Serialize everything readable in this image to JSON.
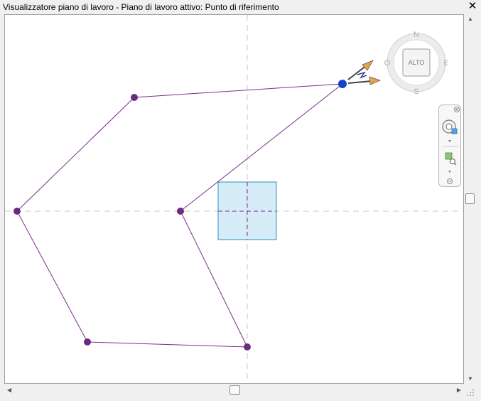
{
  "window": {
    "title": "Visualizzatore piano di lavoro - Piano di lavoro attivo: Punto di riferimento",
    "close_glyph": "✕"
  },
  "viewcube": {
    "face_label": "ALTO",
    "north": "N",
    "south": "S",
    "east": "E",
    "west": "O"
  },
  "scrollbars": {
    "up": "▲",
    "down": "▼",
    "left": "◀",
    "right": "▶"
  },
  "colors": {
    "polyline": "#7b2d8b",
    "vertex": "#6a2c7e",
    "selected_vertex": "#1144cc",
    "workplane_fill": "#d6ecf7",
    "workplane_stroke": "#2f8fc2",
    "axis_dash": "#c8c8c8"
  }
}
